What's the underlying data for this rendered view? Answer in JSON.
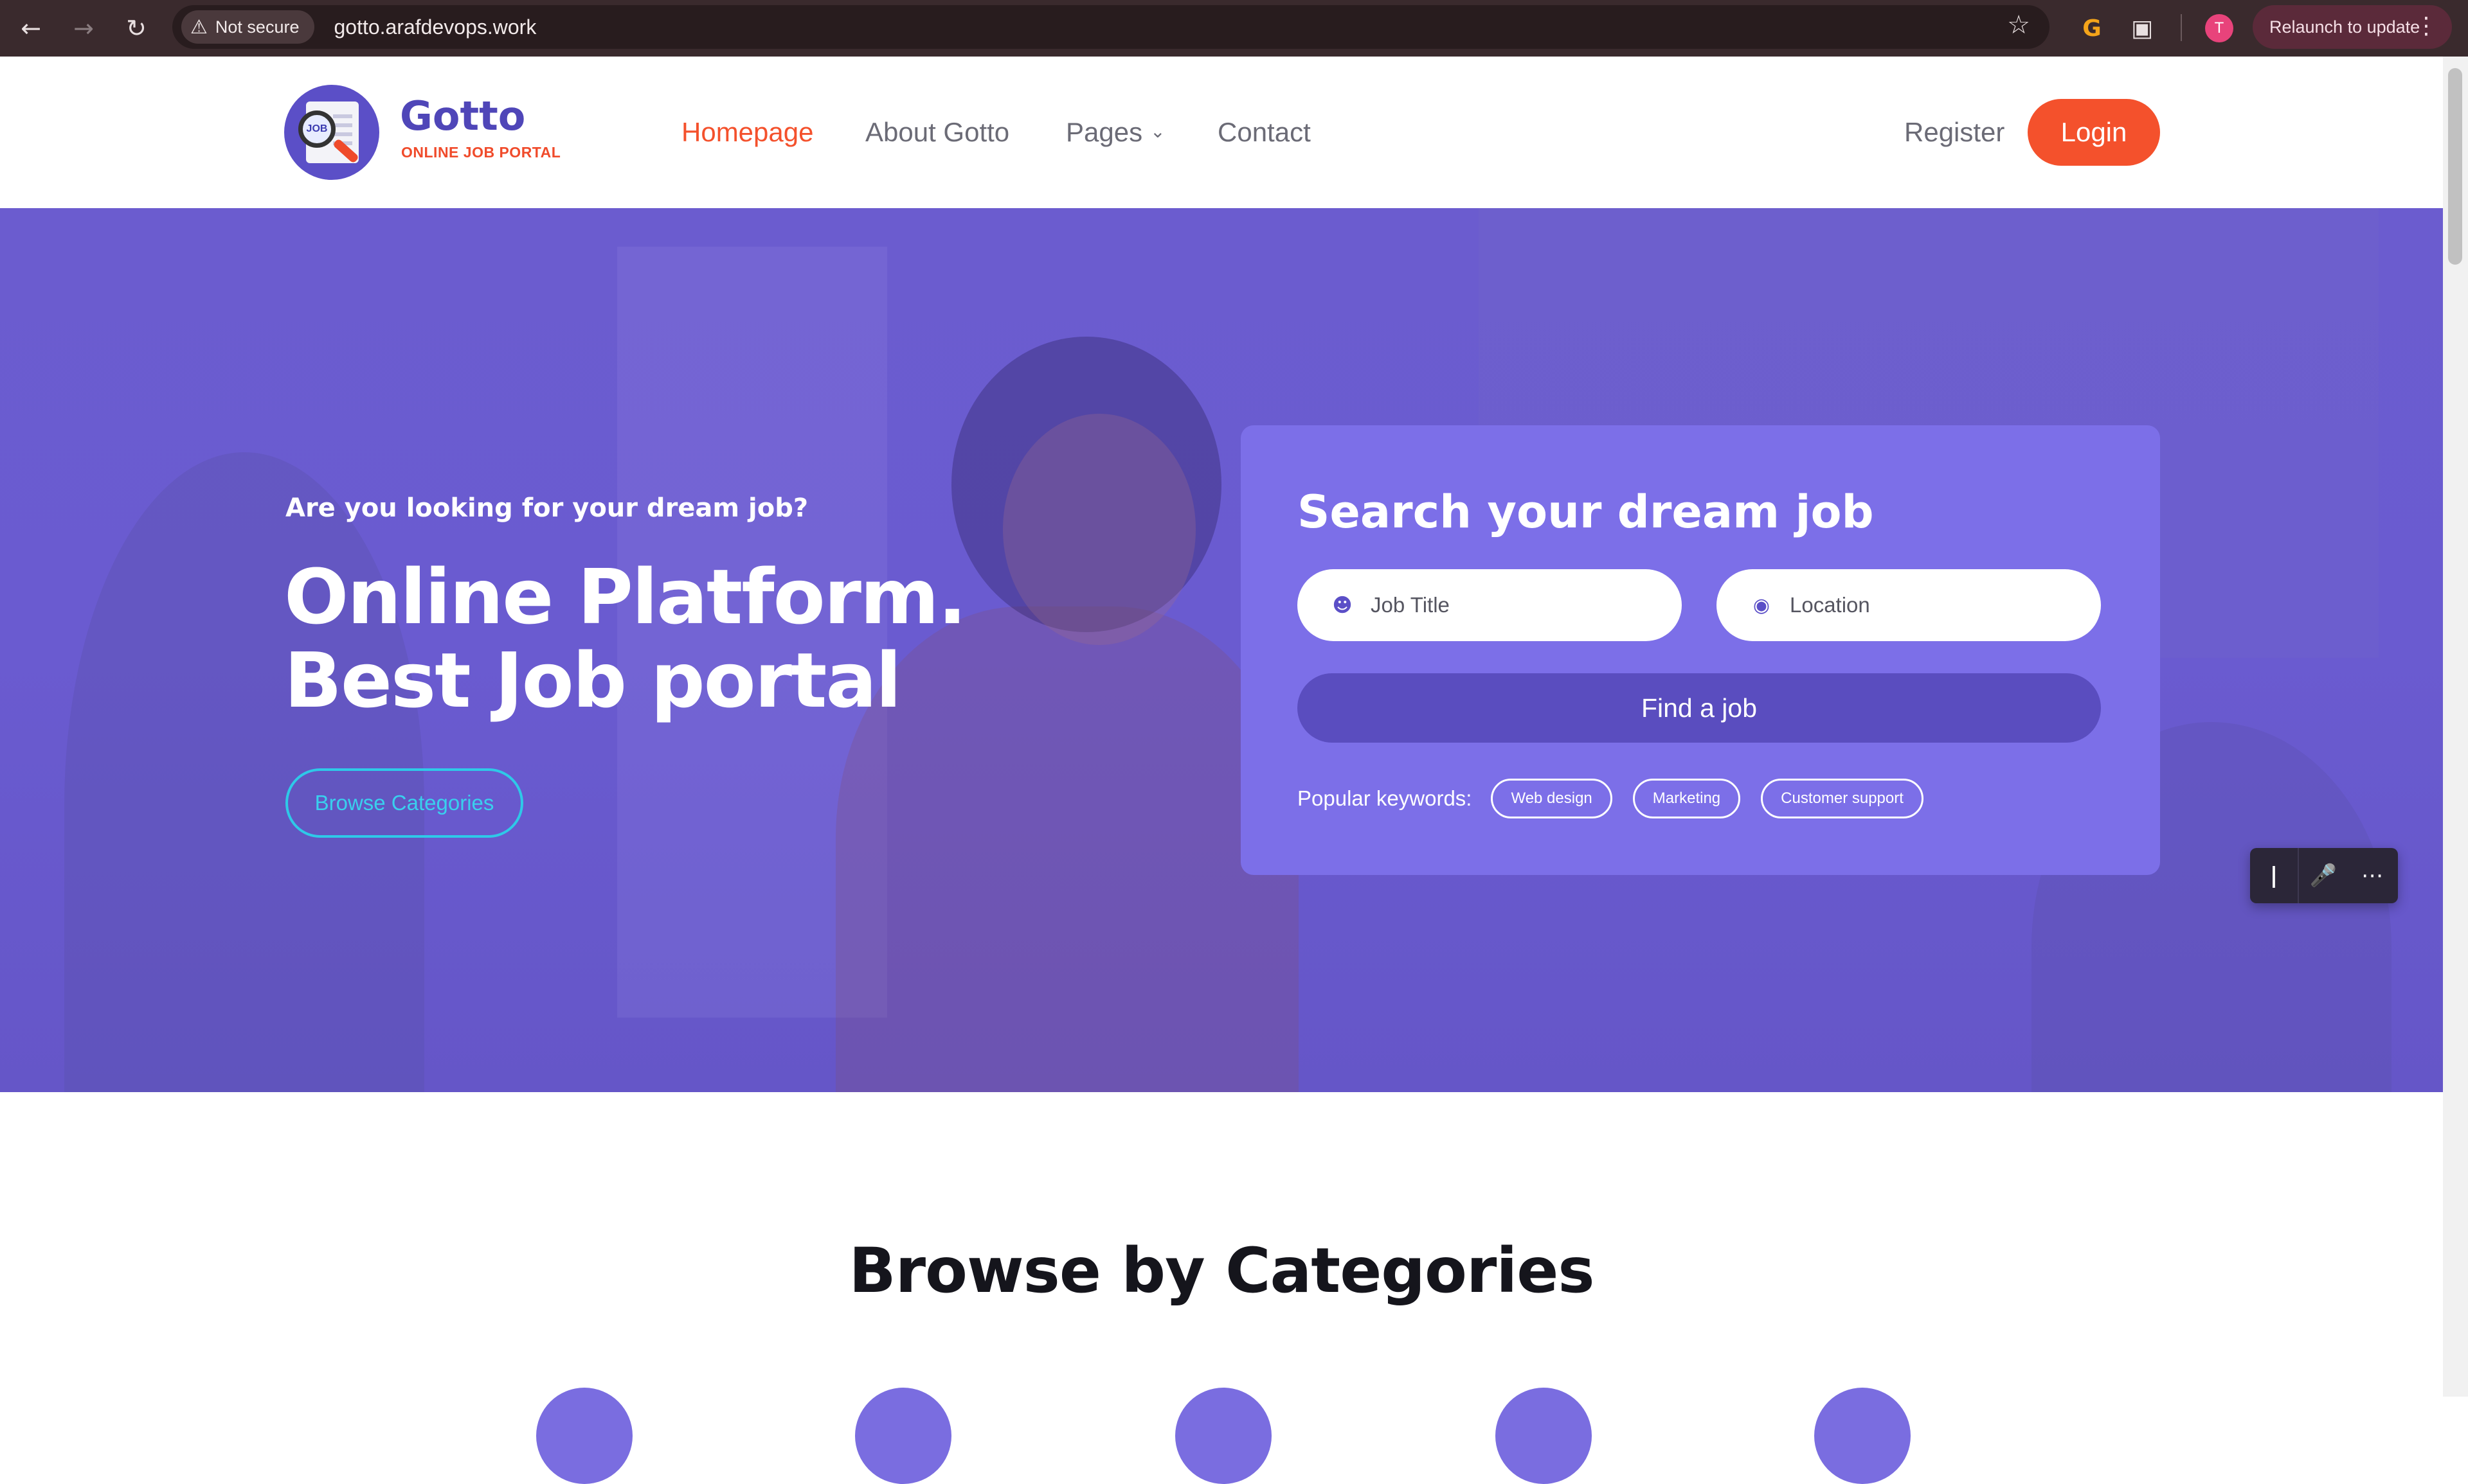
{
  "browser": {
    "security_label": "Not secure",
    "url": "gotto.arafdevops.work",
    "profile_initial": "T",
    "relaunch_label": "Relaunch to update",
    "icons": {
      "back": "arrow-left-icon",
      "forward": "arrow-right-icon",
      "reload": "reload-icon",
      "warning": "warning-icon",
      "bookmark": "star-icon",
      "extension_g": "g-extension-icon",
      "extensions": "puzzle-icon",
      "menu": "kebab-menu-icon"
    }
  },
  "header": {
    "brand_name": "Gotto",
    "brand_tagline": "ONLINE JOB PORTAL",
    "logo_text": "JOB",
    "nav": [
      {
        "label": "Homepage",
        "active": true
      },
      {
        "label": "About Gotto",
        "active": false
      },
      {
        "label": "Pages",
        "active": false
      },
      {
        "label": "Contact",
        "active": false
      }
    ],
    "register_label": "Register",
    "login_label": "Login",
    "colors": {
      "accent": "#f4512c",
      "brand": "#4f46b8"
    }
  },
  "hero": {
    "eyebrow": "Are you looking for your dream job?",
    "title_line1": "Online Platform.",
    "title_line2": "Best Job portal",
    "browse_button": "Browse Categories",
    "background_color": "#6a5bd0"
  },
  "search": {
    "title": "Search your dream job",
    "job_placeholder": "Job Title",
    "location_placeholder": "Location",
    "find_button": "Find a job",
    "keywords_label": "Popular keywords:",
    "keywords": [
      "Web design",
      "Marketing",
      "Customer support"
    ]
  },
  "voice_widget": {
    "icons": [
      "cursor-icon",
      "microphone-icon",
      "more-icon"
    ]
  },
  "categories": {
    "title": "Browse by Categories"
  }
}
